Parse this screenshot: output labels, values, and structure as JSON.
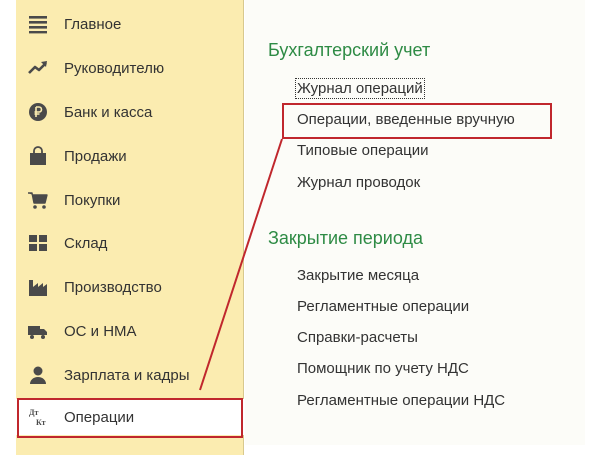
{
  "sidebar": {
    "items": [
      {
        "label": "Главное",
        "icon": "menu-lines-icon"
      },
      {
        "label": "Руководителю",
        "icon": "trend-chart-icon"
      },
      {
        "label": "Банк и касса",
        "icon": "ruble-coin-icon"
      },
      {
        "label": "Продажи",
        "icon": "shopping-bag-icon"
      },
      {
        "label": "Покупки",
        "icon": "shopping-cart-icon"
      },
      {
        "label": "Склад",
        "icon": "warehouse-grid-icon"
      },
      {
        "label": "Производство",
        "icon": "factory-icon"
      },
      {
        "label": "ОС и НМА",
        "icon": "truck-icon"
      },
      {
        "label": "Зарплата и кадры",
        "icon": "person-icon"
      },
      {
        "label": "Операции",
        "icon": "dt-kt-icon",
        "active": true
      }
    ],
    "dt_kt_icon_text": {
      "top": "Дт",
      "bottom": "Кт"
    }
  },
  "content": {
    "sections": [
      {
        "title": "Бухгалтерский учет",
        "links": [
          "Журнал операций",
          "Операции, введенные вручную",
          "Типовые операции",
          "Журнал проводок"
        ]
      },
      {
        "title": "Закрытие периода",
        "links": [
          "Закрытие месяца",
          "Регламентные операции",
          "Справки-расчеты",
          "Помощник по учету НДС",
          "Регламентные операции НДС"
        ]
      }
    ]
  },
  "colors": {
    "sidebar_bg": "#fbecb0",
    "section_title": "#2e8b45",
    "highlight": "#c0272d",
    "icon": "#4a4a4a"
  }
}
